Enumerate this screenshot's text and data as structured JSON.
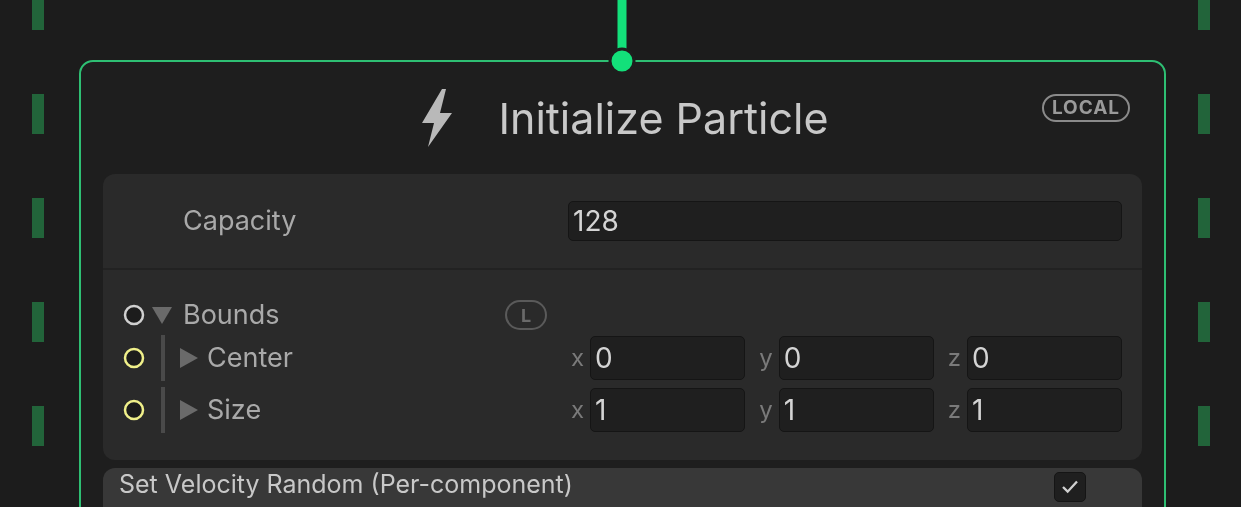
{
  "node": {
    "title": "Initialize Particle",
    "space_badge": "LOCAL"
  },
  "capacity": {
    "label": "Capacity",
    "value": "128"
  },
  "bounds": {
    "label": "Bounds",
    "expanded": true,
    "badge": "L",
    "color": "#d0d0d0",
    "children": [
      {
        "label": "Center",
        "expanded": false,
        "color": "#f0f08a",
        "components": [
          {
            "axis": "x",
            "value": "0"
          },
          {
            "axis": "y",
            "value": "0"
          },
          {
            "axis": "z",
            "value": "0"
          }
        ]
      },
      {
        "label": "Size",
        "expanded": false,
        "color": "#f0f08a",
        "components": [
          {
            "axis": "x",
            "value": "1"
          },
          {
            "axis": "y",
            "value": "1"
          },
          {
            "axis": "z",
            "value": "1"
          }
        ]
      }
    ]
  },
  "next_block": {
    "title": "Set Velocity Random (Per-component)",
    "enabled": true
  }
}
